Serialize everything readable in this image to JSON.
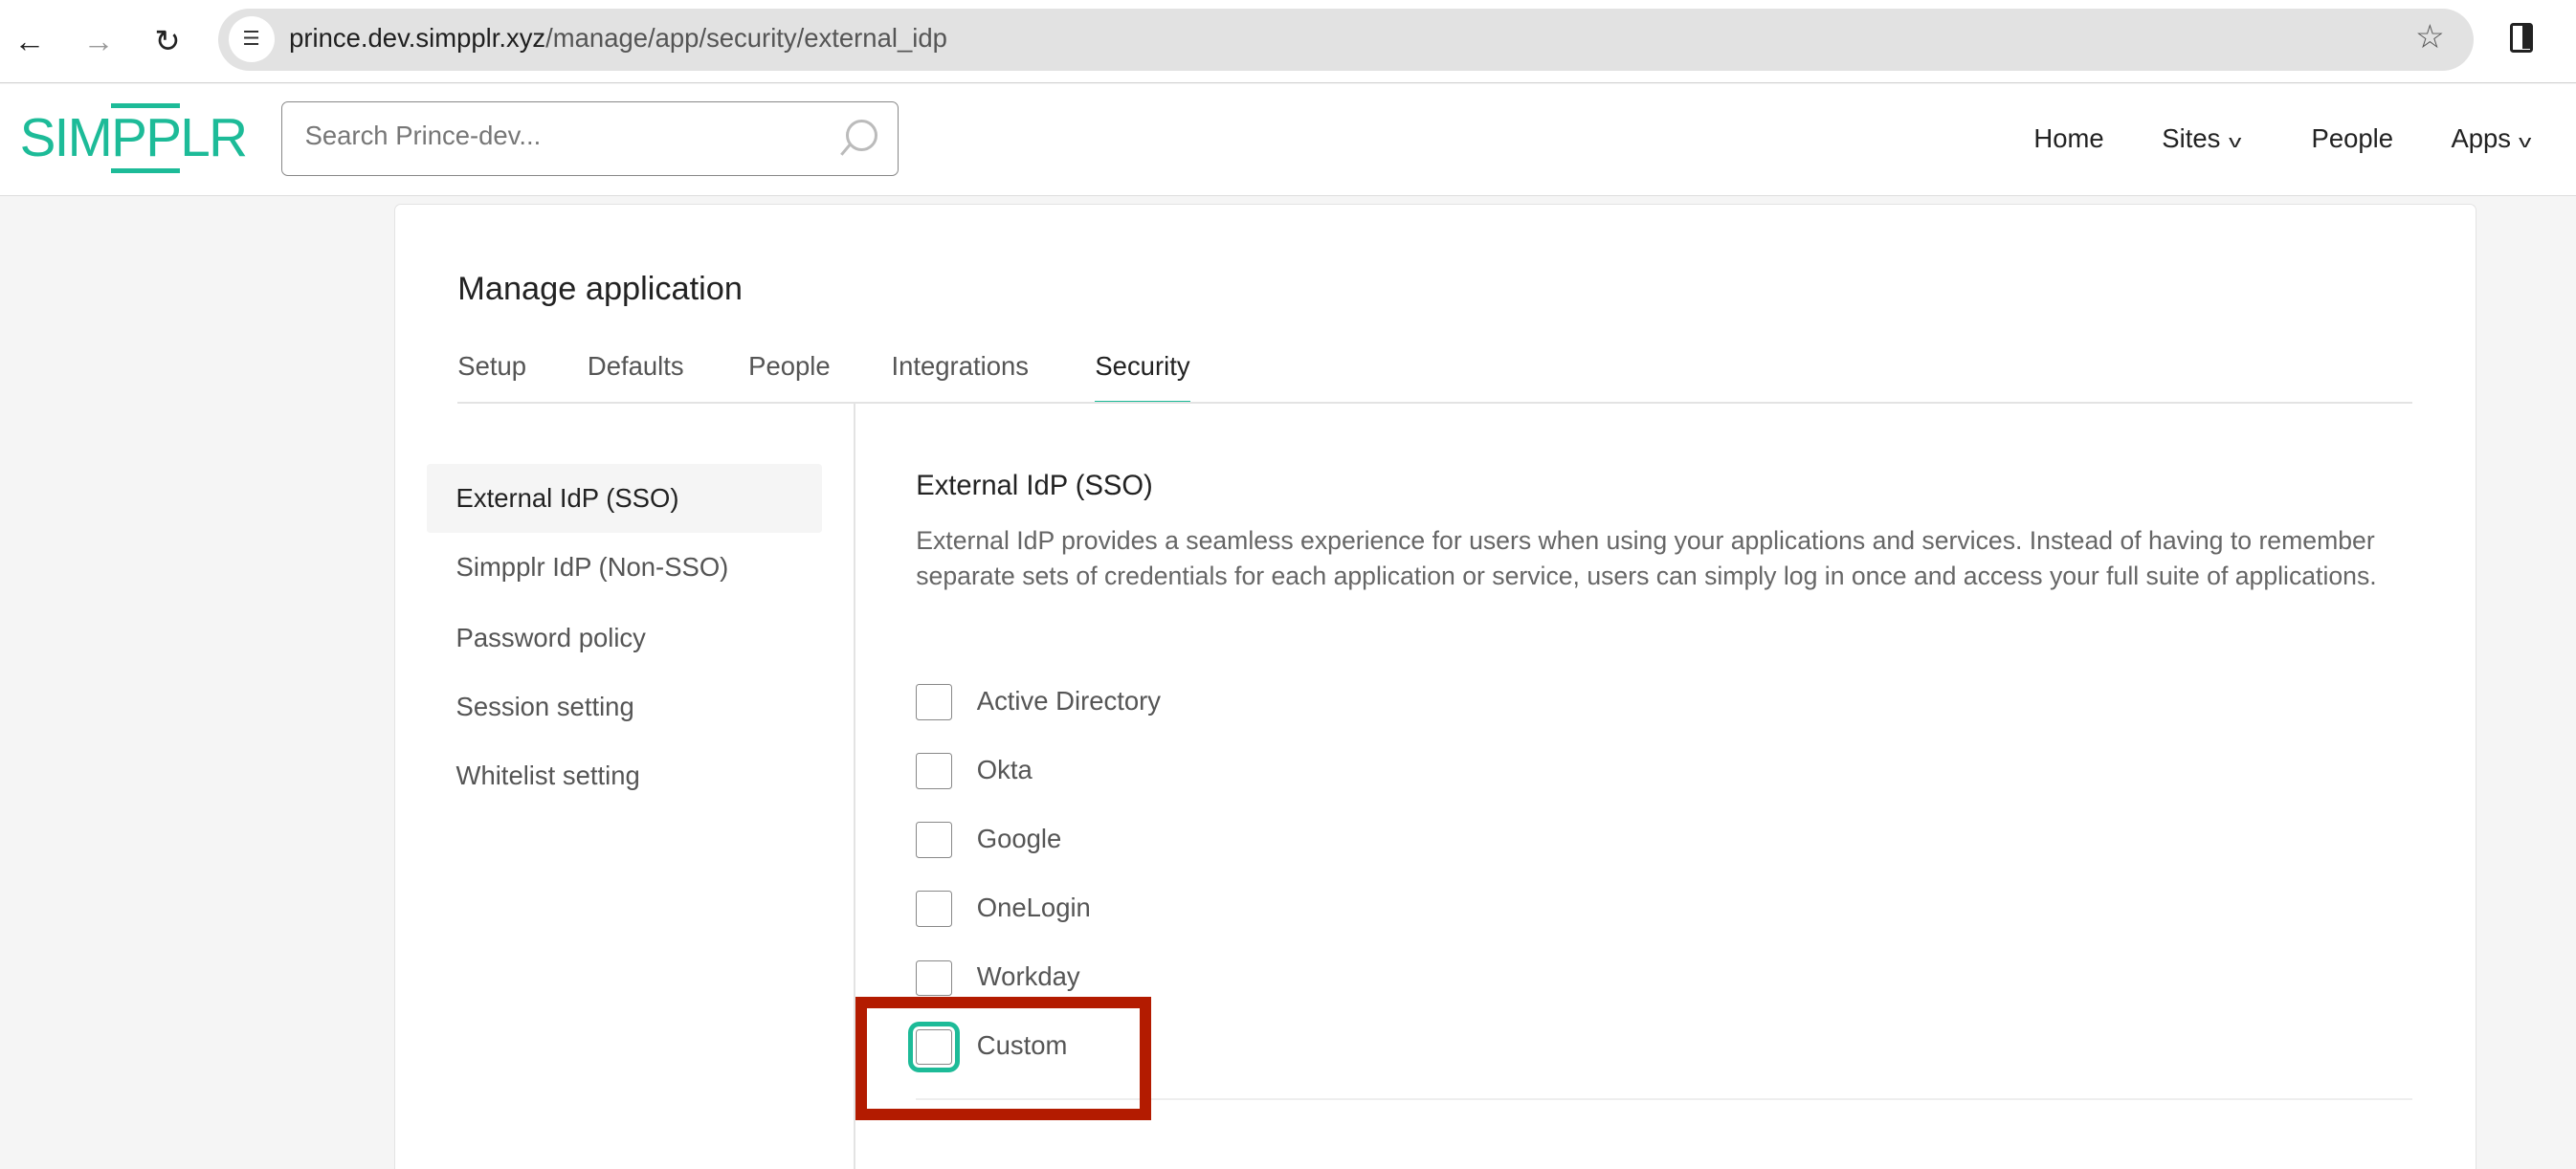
{
  "browser": {
    "url_host": "prince.dev.simpplr.xyz",
    "url_path": "/manage/app/security/external_idp",
    "icons": [
      "back-arrow-icon",
      "forward-arrow-icon",
      "reload-icon",
      "site-info-icon",
      "star-icon",
      "side-panel-icon"
    ]
  },
  "header": {
    "logo_pre": "SIM",
    "logo_pp": "PP",
    "logo_post": "LR",
    "search_placeholder": "Search Prince-dev...",
    "nav": [
      {
        "label": "Home"
      },
      {
        "label": "Sites",
        "dropdown": true
      },
      {
        "label": "People"
      },
      {
        "label": "Apps",
        "dropdown": true
      }
    ]
  },
  "page": {
    "title": "Manage application",
    "tabs": [
      {
        "label": "Setup"
      },
      {
        "label": "Defaults"
      },
      {
        "label": "People"
      },
      {
        "label": "Integrations"
      },
      {
        "label": "Security",
        "active": true
      }
    ],
    "sidebar": [
      {
        "label": "External IdP (SSO)",
        "active": true
      },
      {
        "label": "Simpplr IdP (Non-SSO)"
      },
      {
        "label": "Password policy"
      },
      {
        "label": "Session setting"
      },
      {
        "label": "Whitelist setting"
      }
    ],
    "section_title": "External IdP (SSO)",
    "section_description": "External IdP provides a seamless experience for users when using your applications and services. Instead of having to remember separate sets of credentials for each application or service, users can simply log in once and access your full suite of applications.",
    "providers": [
      {
        "label": "Active Directory",
        "checked": false
      },
      {
        "label": "Okta",
        "checked": false
      },
      {
        "label": "Google",
        "checked": false
      },
      {
        "label": "OneLogin",
        "checked": false
      },
      {
        "label": "Workday",
        "checked": false
      },
      {
        "label": "Custom",
        "checked": false,
        "focused": true
      }
    ]
  },
  "colors": {
    "accent": "#1dbb98",
    "highlight": "#b31b00"
  }
}
